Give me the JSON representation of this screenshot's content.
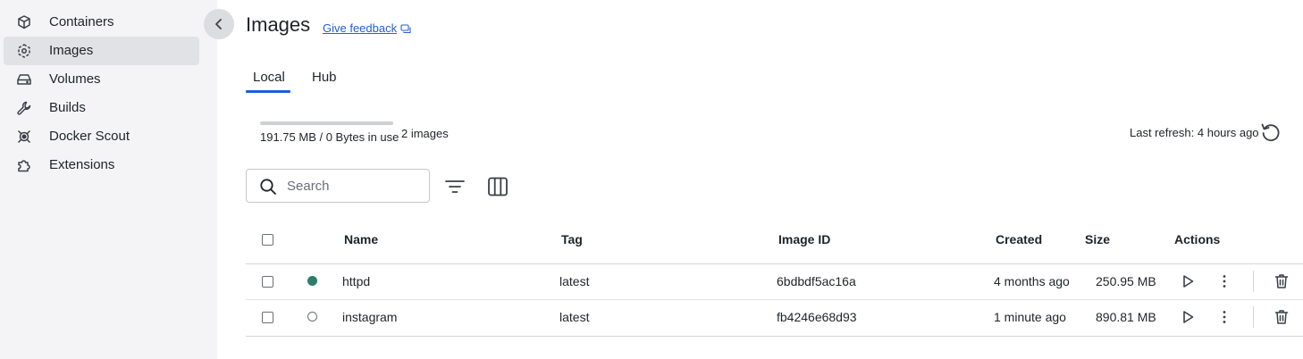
{
  "sidebar": {
    "items": [
      {
        "label": "Containers",
        "icon": "cube-icon",
        "active": false
      },
      {
        "label": "Images",
        "icon": "image-layers-icon",
        "active": true
      },
      {
        "label": "Volumes",
        "icon": "drive-icon",
        "active": false
      },
      {
        "label": "Builds",
        "icon": "wrench-icon",
        "active": false
      },
      {
        "label": "Docker Scout",
        "icon": "scout-icon",
        "active": false
      },
      {
        "label": "Extensions",
        "icon": "puzzle-icon",
        "active": false
      }
    ],
    "collapse_icon": "chevron-left-icon"
  },
  "header": {
    "title": "Images",
    "feedback_label": "Give feedback"
  },
  "tabs": [
    {
      "label": "Local",
      "active": true
    },
    {
      "label": "Hub",
      "active": false
    }
  ],
  "usage": {
    "text": "191.75 MB / 0 Bytes in use",
    "fraction": 0,
    "count": "2 images"
  },
  "refresh": {
    "text": "Last refresh: 4 hours ago"
  },
  "search": {
    "placeholder": "Search",
    "value": ""
  },
  "table": {
    "columns": [
      "Name",
      "Tag",
      "Image ID",
      "Created",
      "Size",
      "Actions"
    ],
    "rows": [
      {
        "name": "httpd",
        "tag": "latest",
        "image_id": "6bdbdf5ac16a",
        "created": "4 months ago",
        "size": "250.95 MB",
        "in_use": true
      },
      {
        "name": "instagram",
        "tag": "latest",
        "image_id": "fb4246e68d93",
        "created": "1 minute ago",
        "size": "890.81 MB",
        "in_use": false
      }
    ]
  },
  "colors": {
    "accent": "#1f5fd6",
    "in_use_status": "#2e7d6b",
    "sidebar_bg": "#f4f4f6",
    "sidebar_active": "#e1e2e6"
  }
}
